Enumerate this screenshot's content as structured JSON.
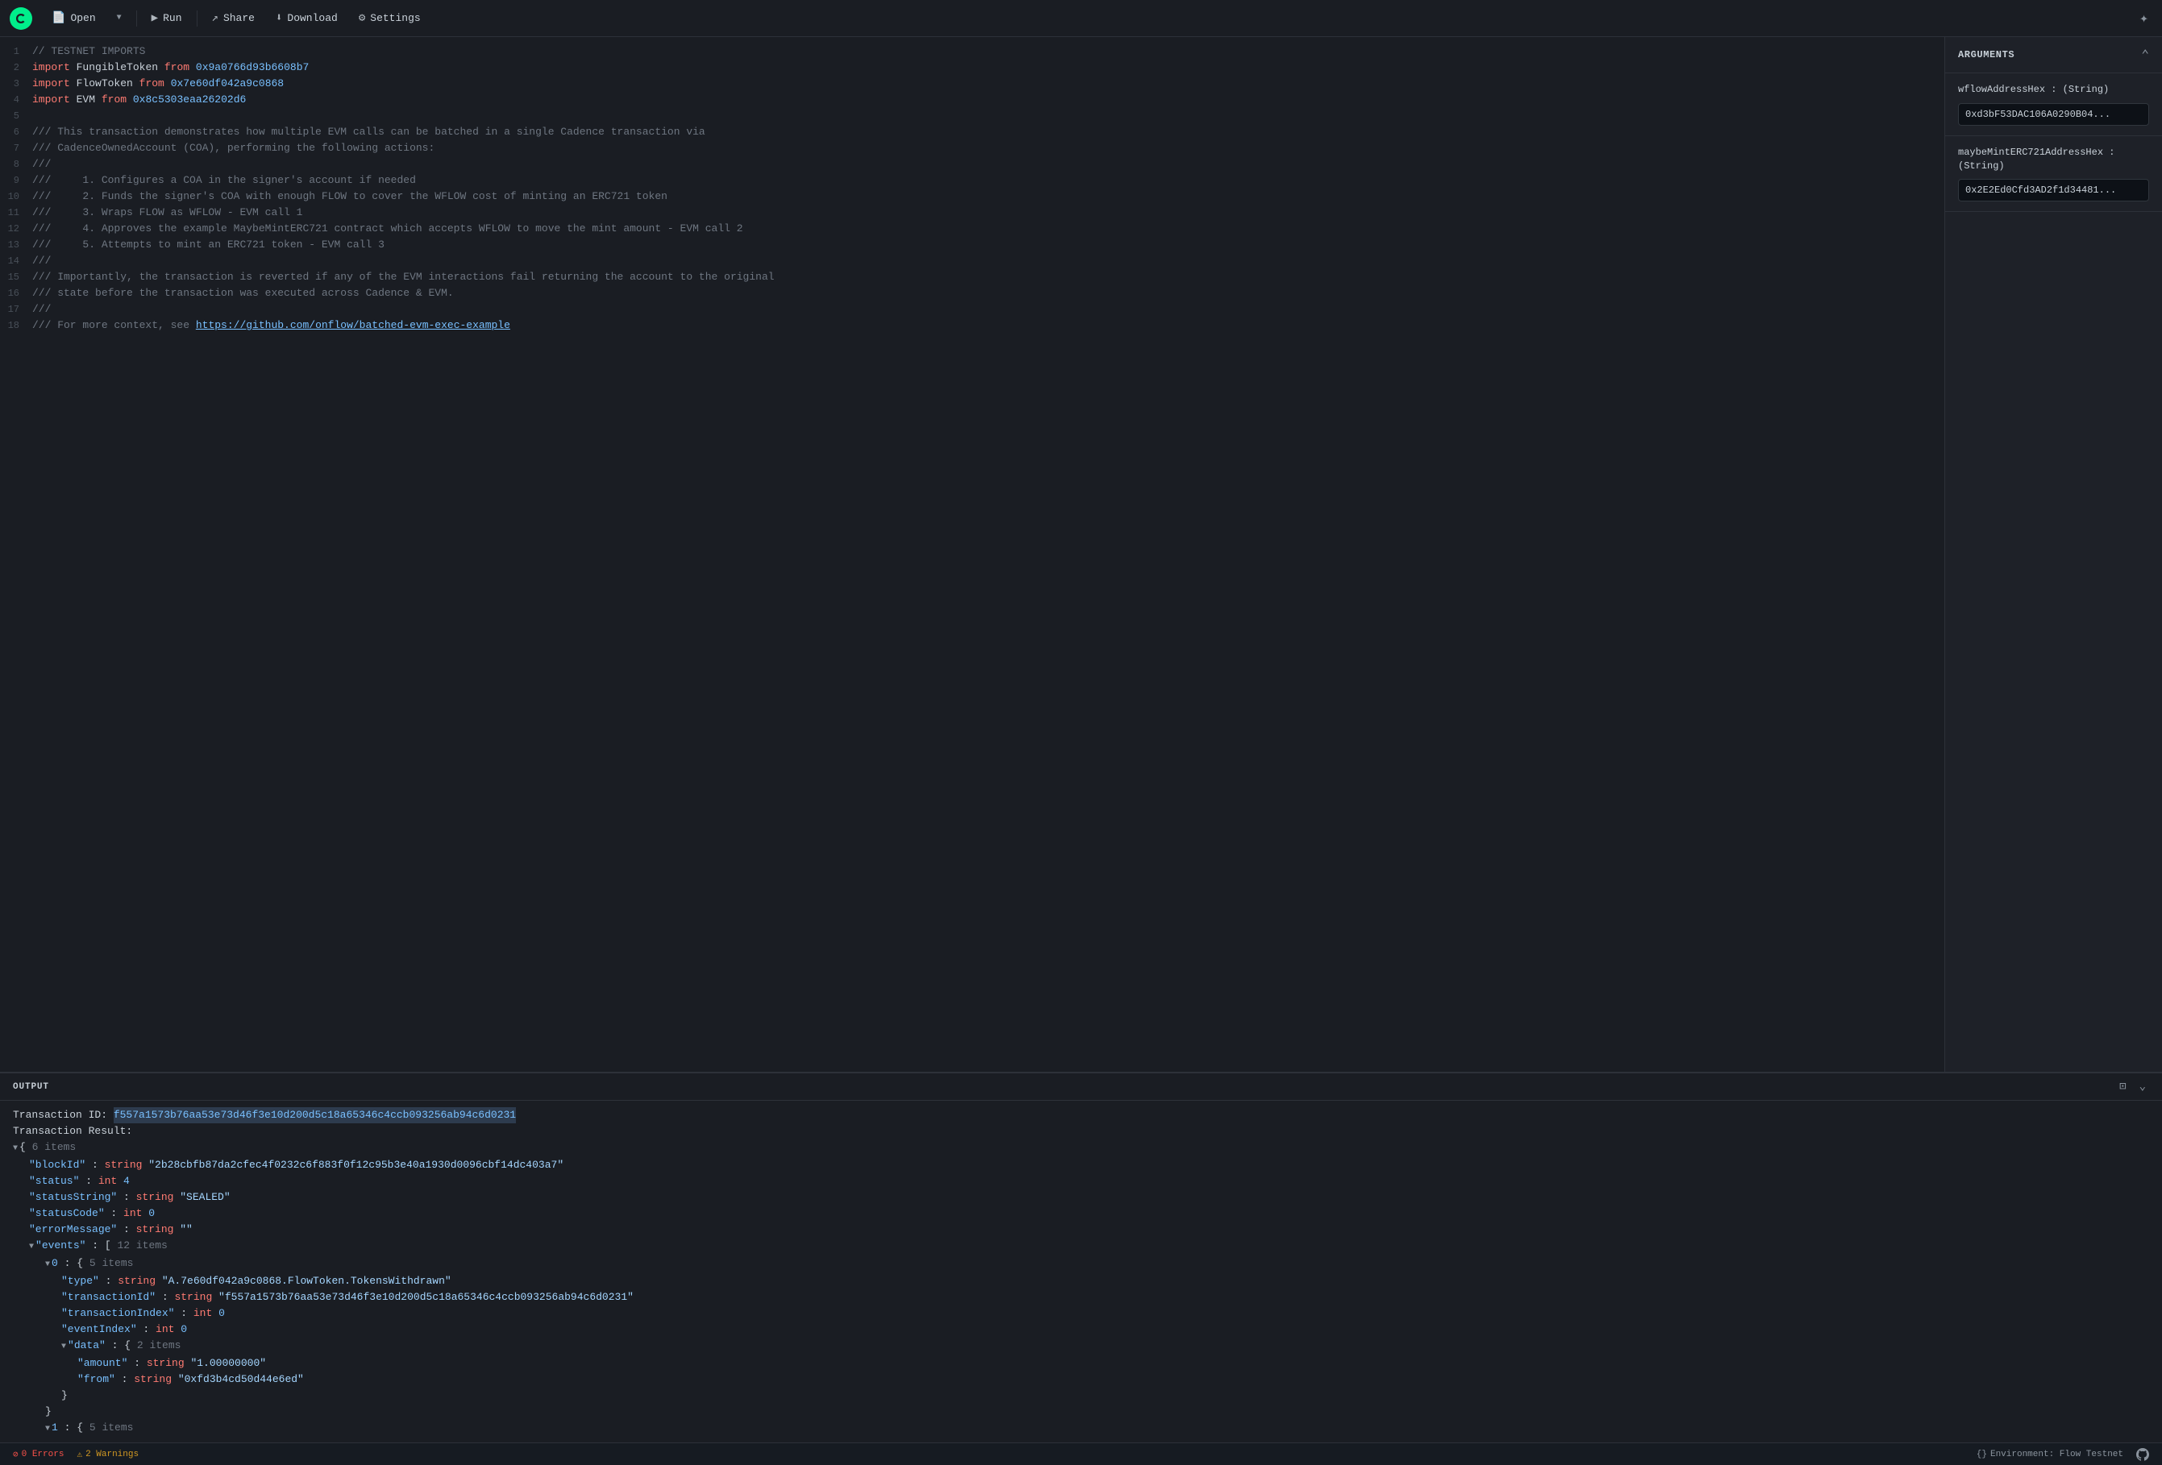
{
  "toolbar": {
    "open_label": "Open",
    "run_label": "Run",
    "share_label": "Share",
    "download_label": "Download",
    "settings_label": "Settings"
  },
  "arguments": {
    "title": "ARGUMENTS",
    "fields": [
      {
        "label": "wflowAddressHex : (String)",
        "value": "0xd3bF53DAC106A0290B04..."
      },
      {
        "label": "maybeMintERC721AddressHex : (String)",
        "value": "0x2E2Ed0Cfd3AD2f1d34481..."
      }
    ]
  },
  "code": {
    "lines": [
      {
        "num": 1,
        "content": "// TESTNET IMPORTS",
        "type": "comment"
      },
      {
        "num": 2,
        "content": "import FungibleToken from 0x9a0766d93b6608b7",
        "type": "import"
      },
      {
        "num": 3,
        "content": "import FlowToken from 0x7e60df042a9c0868",
        "type": "import"
      },
      {
        "num": 4,
        "content": "import EVM from 0x8c5303eaa26202d6",
        "type": "import"
      },
      {
        "num": 5,
        "content": "",
        "type": "empty"
      },
      {
        "num": 6,
        "content": "/// This transaction demonstrates how multiple EVM calls can be batched in a single Cadence transaction via",
        "type": "comment"
      },
      {
        "num": 7,
        "content": "/// CadenceOwnedAccount (COA), performing the following actions:",
        "type": "comment"
      },
      {
        "num": 8,
        "content": "///",
        "type": "comment"
      },
      {
        "num": 9,
        "content": "///     1. Configures a COA in the signer's account if needed",
        "type": "comment"
      },
      {
        "num": 10,
        "content": "///     2. Funds the signer's COA with enough FLOW to cover the WFLOW cost of minting an ERC721 token",
        "type": "comment"
      },
      {
        "num": 11,
        "content": "///     3. Wraps FLOW as WFLOW - EVM call 1",
        "type": "comment"
      },
      {
        "num": 12,
        "content": "///     4. Approves the example MaybeMintERC721 contract which accepts WFLOW to move the mint amount - EVM call 2",
        "type": "comment"
      },
      {
        "num": 13,
        "content": "///     5. Attempts to mint an ERC721 token - EVM call 3",
        "type": "comment"
      },
      {
        "num": 14,
        "content": "///",
        "type": "comment"
      },
      {
        "num": 15,
        "content": "/// Importantly, the transaction is reverted if any of the EVM interactions fail returning the account to the original",
        "type": "comment"
      },
      {
        "num": 16,
        "content": "/// state before the transaction was executed across Cadence & EVM.",
        "type": "comment"
      },
      {
        "num": 17,
        "content": "///",
        "type": "comment"
      },
      {
        "num": 18,
        "content": "/// For more context, see https://github.com/onflow/batched-evm-exec-example",
        "type": "comment-link"
      }
    ]
  },
  "output": {
    "title": "OUTPUT",
    "transaction_id_label": "Transaction ID: ",
    "transaction_id_value": "f557a1573b76aa53e73d46f3e10d200d5c18a65346c4ccb093256ab94c6d0231",
    "transaction_result_label": "Transaction Result:",
    "json_tree": {
      "root_count": "6 items",
      "blockId_key": "\"blockId\"",
      "blockId_value": "\"2b28cbfb87da2cfec4f0232c6f883f0f12c95b3e40a1930d0096cbf14dc403a7\"",
      "status_key": "\"status\"",
      "status_value": "4",
      "statusString_key": "\"statusString\"",
      "statusString_value": "\"SEALED\"",
      "statusCode_key": "\"statusCode\"",
      "statusCode_value": "0",
      "errorMessage_key": "\"errorMessage\"",
      "errorMessage_value": "\"\"",
      "events_key": "\"events\"",
      "events_count": "12 items",
      "event_0_count": "5 items",
      "type_key": "\"type\"",
      "type_value": "\"A.7e60df042a9c0868.FlowToken.TokensWithdrawn\"",
      "transactionId_key": "\"transactionId\"",
      "transactionId_value": "\"f557a1573b76aa53e73d46f3e10d200d5c18a65346c4ccb093256ab94c6d0231\"",
      "transactionIndex_key": "\"transactionIndex\"",
      "transactionIndex_value": "0",
      "eventIndex_key": "\"eventIndex\"",
      "eventIndex_value": "0",
      "data_count": "2 items",
      "amount_key": "\"amount\"",
      "amount_value": "\"1.00000000\"",
      "from_key": "\"from\"",
      "from_value": "\"0xfd3b4cd50d44e6ed\"",
      "event_1_count": "5 items"
    }
  },
  "status_bar": {
    "errors_count": "0 Errors",
    "warnings_count": "2 Warnings",
    "environment": "Environment: Flow Testnet"
  }
}
